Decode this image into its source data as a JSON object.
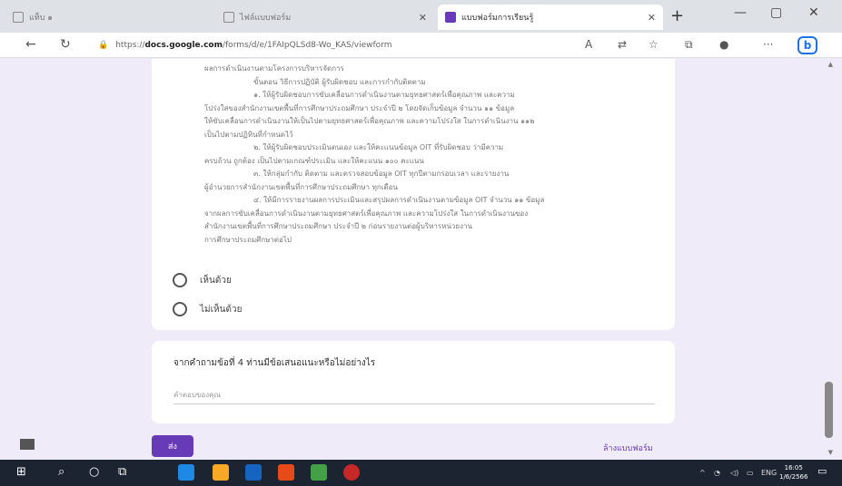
{
  "browser": {
    "tabs": [
      {
        "label": "แท็บ ๑"
      },
      {
        "label": "ไฟล์แบบฟอร์ม"
      },
      {
        "label": "แบบฟอร์มการเรียนรู้"
      }
    ],
    "url_prefix": "https://",
    "url_domain": "docs.google.com",
    "url_path": "/forms/d/e/1FAIpQLSd8-Wo_KAS/viewform"
  },
  "form": {
    "paragraph_lines": [
      "ผลการดำเนินงานตามโครงการบริหารจัดการ",
      "ขั้นตอน วิธีการปฏิบัติ ผู้รับผิดชอบ และการกำกับติดตาม",
      "๑. ให้ผู้รับผิดชอบการขับเคลื่อนการดำเนินงานตามยุทธศาสตร์เพื่อคุณภาพ และความ",
      "โปร่งใสของสำนักงานเขตพื้นที่การศึกษาประถมศึกษา ประจำปี ๒ โดยจัดเก็บข้อมูล จำนวน ๑๑ ข้อมูล",
      "ให้ขับเคลื่อนการดำเนินงานให้เป็นไปตามยุทธศาสตร์เพื่อคุณภาพ และความโปร่งใส ในการดำเนินงาน ๑๑๒",
      "เป็นไปตามปฏิทินที่กำหนดไว้",
      "๒. ให้ผู้รับผิดชอบประเมินตนเอง และให้คะแนนข้อมูล OIT ที่รับผิดชอบ ว่ามีความ",
      "ครบถ้วน ถูกต้อง เป็นไปตามเกณฑ์ประเมิน และให้คะแนน ๑๐๐ คะแนน",
      "๓. ให้กลุ่มกำกับ ติดตาม และตรวจสอบข้อมูล OIT ทุกปีตามกรอบเวลา และรายงาน",
      "ผู้อำนวยการสำนักงานเขตพื้นที่การศึกษาประถมศึกษา ทุกเดือน",
      "๔. ให้มีการรายงานผลการประเมินและสรุปผลการดำเนินงานตามข้อมูล OIT จำนวน ๑๑ ข้อมูล",
      "จากผลการขับเคลื่อนการดำเนินงานตามยุทธศาสตร์เพื่อคุณภาพ และความโปร่งใส ในการดำเนินงานของ",
      "สำนักงานเขตพื้นที่การศึกษาประถมศึกษา ประจำปี ๒ ก่อนรายงานต่อผู้บริหารหน่วยงาน",
      "การศึกษาประถมศึกษาต่อไป"
    ],
    "options": [
      {
        "label": "เห็นด้วย"
      },
      {
        "label": "ไม่เห็นด้วย"
      }
    ],
    "question_title": "จากคำถามข้อที่ 4 ท่านมีข้อเสนอแนะหรือไม่อย่างไร",
    "answer_placeholder": "คำตอบของคุณ",
    "submit_label": "ส่ง",
    "clear_label": "ล้างแบบฟอร์ม"
  },
  "taskbar": {
    "language": "ENG",
    "time": "16:05",
    "date": "1/6/2566"
  }
}
